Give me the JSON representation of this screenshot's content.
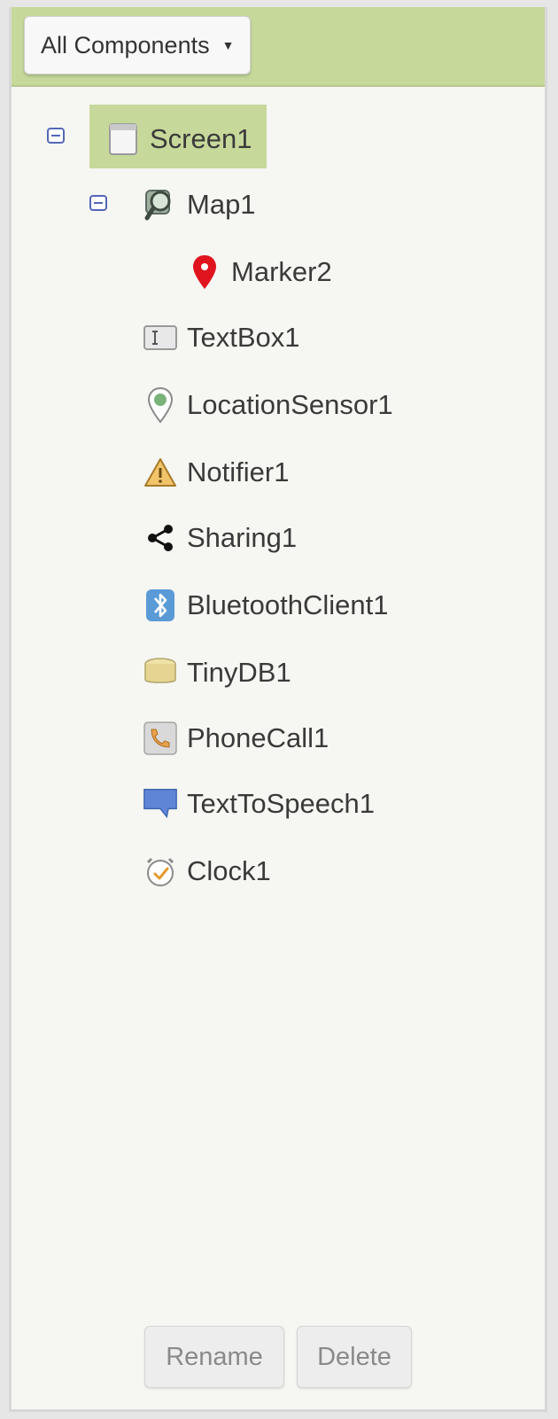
{
  "filter": {
    "label": "All Components"
  },
  "tree": {
    "screen": {
      "label": "Screen1"
    },
    "map": {
      "label": "Map1"
    },
    "marker": {
      "label": "Marker2"
    },
    "items": [
      {
        "label": "TextBox1",
        "icon": "textbox-icon"
      },
      {
        "label": "LocationSensor1",
        "icon": "location-sensor-icon"
      },
      {
        "label": "Notifier1",
        "icon": "warning-icon"
      },
      {
        "label": "Sharing1",
        "icon": "share-icon"
      },
      {
        "label": "BluetoothClient1",
        "icon": "bluetooth-icon"
      },
      {
        "label": "TinyDB1",
        "icon": "database-icon"
      },
      {
        "label": "PhoneCall1",
        "icon": "phone-icon"
      },
      {
        "label": "TextToSpeech1",
        "icon": "speech-bubble-icon"
      },
      {
        "label": "Clock1",
        "icon": "clock-icon"
      }
    ]
  },
  "actions": {
    "rename": "Rename",
    "delete": "Delete"
  },
  "colors": {
    "header": "#c6d99b",
    "selected": "#c6d99b",
    "panel": "#f6f6f2",
    "toggle": "#5367b8",
    "marker": "#e0141e"
  }
}
